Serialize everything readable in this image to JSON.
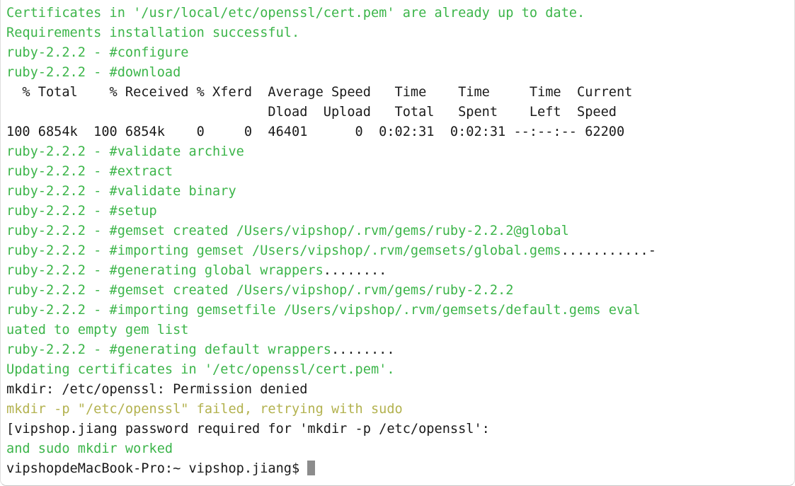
{
  "terminal": {
    "background_color": "#ffffff",
    "colors": {
      "green": "#3cb54a",
      "black": "#1a1a1a",
      "yellow": "#b3b24f",
      "cursor": "#8c8c8c"
    },
    "prompt": "vipshopdeMacBook-Pro:~ vipshop.jiang$ ",
    "cursor_glyph": "block-cursor",
    "lines": [
      {
        "text": "Certificates in '/usr/local/etc/openssl/cert.pem' are already up to date.",
        "color": "green"
      },
      {
        "text": "Requirements installation successful.",
        "color": "green"
      },
      {
        "text": "ruby-2.2.2 - #configure",
        "color": "green"
      },
      {
        "text": "ruby-2.2.2 - #download",
        "color": "green"
      },
      {
        "text": "  % Total    % Received % Xferd  Average Speed   Time    Time     Time  Current",
        "color": "black"
      },
      {
        "text": "                                 Dload  Upload   Total   Spent    Left  Speed",
        "color": "black"
      },
      {
        "text": "100 6854k  100 6854k    0     0  46401      0  0:02:31  0:02:31 --:--:-- 62200",
        "color": "black"
      },
      {
        "text": "ruby-2.2.2 - #validate archive",
        "color": "green"
      },
      {
        "text": "ruby-2.2.2 - #extract",
        "color": "green"
      },
      {
        "text": "ruby-2.2.2 - #validate binary",
        "color": "green"
      },
      {
        "text": "ruby-2.2.2 - #setup",
        "color": "green"
      },
      {
        "text": "ruby-2.2.2 - #gemset created /Users/vipshop/.rvm/gems/ruby-2.2.2@global",
        "color": "green"
      },
      {
        "text": "ruby-2.2.2 - #importing gemset /Users/vipshop/.rvm/gemsets/global.gems",
        "color": "green",
        "suffix_dots": 11,
        "suffix_dash": true
      },
      {
        "text": "ruby-2.2.2 - #generating global wrappers",
        "color": "green",
        "suffix_dots": 8
      },
      {
        "text": "ruby-2.2.2 - #gemset created /Users/vipshop/.rvm/gems/ruby-2.2.2",
        "color": "green"
      },
      {
        "text": "ruby-2.2.2 - #importing gemsetfile /Users/vipshop/.rvm/gemsets/default.gems eval",
        "color": "green"
      },
      {
        "text": "uated to empty gem list",
        "color": "green"
      },
      {
        "text": "ruby-2.2.2 - #generating default wrappers",
        "color": "green",
        "suffix_dots": 8
      },
      {
        "text": "Updating certificates in '/etc/openssl/cert.pem'.",
        "color": "green"
      },
      {
        "text": "mkdir: /etc/openssl: Permission denied",
        "color": "black"
      },
      {
        "text": "mkdir -p \"/etc/openssl\" failed, retrying with sudo",
        "color": "yellow"
      },
      {
        "text": "[vipshop.jiang password required for 'mkdir -p /etc/openssl':",
        "color": "black"
      },
      {
        "text": "and sudo mkdir worked",
        "color": "green"
      }
    ]
  }
}
